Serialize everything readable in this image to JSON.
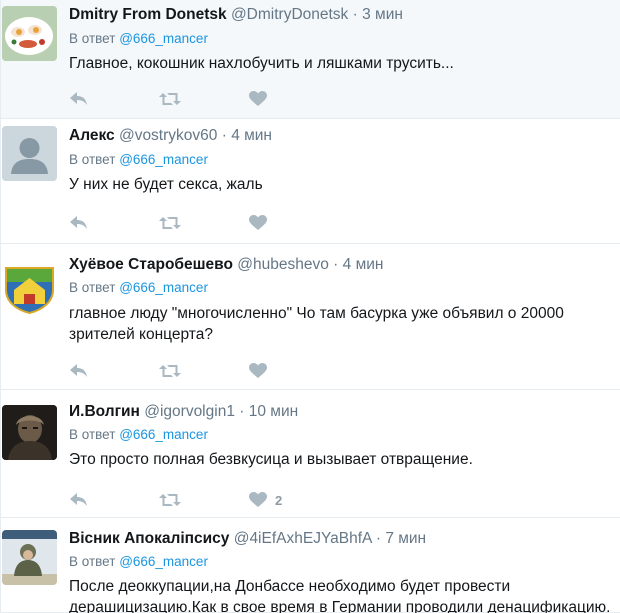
{
  "tweets": [
    {
      "fullname": "Dmitry From Donetsk",
      "handle": "@DmitryDonetsk",
      "time": "3 мин",
      "reply_prefix": "В ответ",
      "reply_to": "@666_mancer",
      "text": "Главное, кокошник нахлобучить и ляшками трусить...",
      "likes": ""
    },
    {
      "fullname": "Алекс",
      "handle": "@vostrykov60",
      "time": "4 мин",
      "reply_prefix": "В ответ",
      "reply_to": "@666_mancer",
      "text": "У них не будет секса, жаль",
      "likes": ""
    },
    {
      "fullname": "Хуёвое Старобешево",
      "handle": "@hubeshevo",
      "time": "4 мин",
      "reply_prefix": "В ответ",
      "reply_to": "@666_mancer",
      "text_lines": [
        "главное люду \"многочисленно\" Чо там басурка уже объявил о 20000",
        "зрителей концерта?"
      ],
      "likes": ""
    },
    {
      "fullname": "И.Волгин",
      "handle": "@igorvolgin1",
      "time": "10 мин",
      "reply_prefix": "В ответ",
      "reply_to": "@666_mancer",
      "text": "Это просто полная безвкусица и вызывает отвращение.",
      "likes": "2"
    },
    {
      "fullname": "Вісник Апокаліпсису",
      "handle": "@4iEfAxhEJYaBhfA",
      "time": "7 мин",
      "reply_prefix": "В ответ",
      "reply_to": "@666_mancer",
      "text_lines": [
        "После деоккупации,на Донбассе необходимо будет провести",
        "дерашицизацию.Как в свое время в Германии проводили денацификацию."
      ],
      "likes": ""
    }
  ],
  "separator": "·",
  "colors": {
    "name": "#14171a",
    "meta": "#657786",
    "mention": "#1b95e0",
    "icon": "#aab8c2",
    "highlight_bg": "#f5f8fa",
    "border": "#e6ecf0"
  },
  "icons": {
    "reply": "reply-icon",
    "retweet": "retweet-icon",
    "like": "heart-icon"
  }
}
